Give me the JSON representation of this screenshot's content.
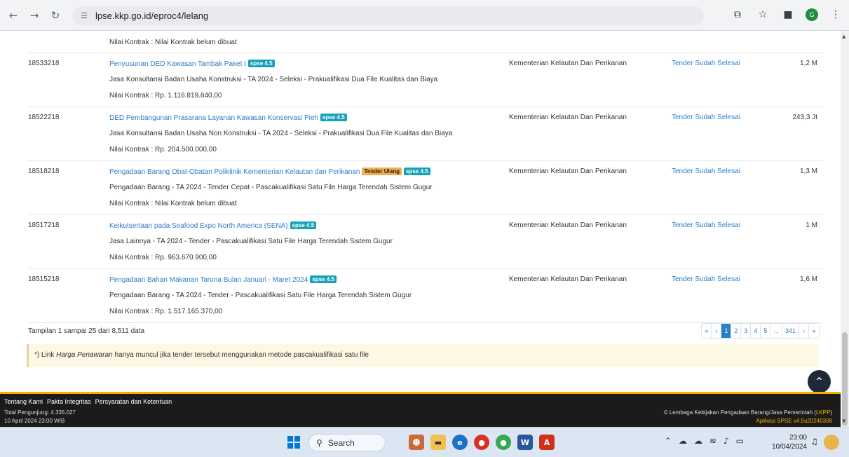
{
  "browser": {
    "url": "lpse.kkp.go.id/eproc4/lelang",
    "profile_initial": "G"
  },
  "table": {
    "first_row": {
      "nilai": "Nilai Kontrak : Nilai Kontrak belum dibuat"
    },
    "rows": [
      {
        "id": "18533218",
        "title": "Penyusunan DED Kawasan Tambak Paket I",
        "badges": [
          "spse 4.5"
        ],
        "jenis": "Jasa Konsultansi Badan Usaha Konstruksi - TA 2024 - Seleksi - Prakualifikasi Dua File Kualitas dan Biaya",
        "nilai": "Nilai Kontrak : Rp. 1.116.819.840,00",
        "instansi": "Kementerian Kelautan Dan Perikanan",
        "status": "Tender Sudah Selesai",
        "hps": "1,2 M"
      },
      {
        "id": "18522218",
        "title": "DED Pembangunan Prasarana Layanan Kawasan Konservasi Pieh",
        "badges": [
          "spse 4.5"
        ],
        "jenis": "Jasa Konsultansi Badan Usaha Non Konstruksi - TA 2024 - Seleksi - Prakualifikasi Dua File Kualitas dan Biaya",
        "nilai": "Nilai Kontrak : Rp. 204.500.000,00",
        "instansi": "Kementerian Kelautan Dan Perikanan",
        "status": "Tender Sudah Selesai",
        "hps": "243,3 Jt"
      },
      {
        "id": "18518218",
        "title": "Pengadaan Barang Obat-Obatan Poliklinik Kementerian Kelautan dan Perikanan",
        "badges": [
          "Tender Ulang",
          "spse 4.5"
        ],
        "jenis": "Pengadaan Barang - TA 2024 - Tender Cepat - Pascakualifikasi Satu File Harga Terendah Sistem Gugur",
        "nilai": "Nilai Kontrak : Nilai Kontrak belum dibuat",
        "instansi": "Kementerian Kelautan Dan Perikanan",
        "status": "Tender Sudah Selesai",
        "hps": "1,3 M"
      },
      {
        "id": "18517218",
        "title": "Keikutsertaan pada Seafood Expo North America (SENA)",
        "badges": [
          "spse 4.5"
        ],
        "jenis": "Jasa Lainnya - TA 2024 - Tender - Pascakualifikasi Satu File Harga Terendah Sistem Gugur",
        "nilai": "Nilai Kontrak : Rp. 963.670.900,00",
        "instansi": "Kementerian Kelautan Dan Perikanan",
        "status": "Tender Sudah Selesai",
        "hps": "1 M"
      },
      {
        "id": "18515218",
        "title": "Pengadaan Bahan Makanan Taruna Bulan Januari - Maret 2024",
        "badges": [
          "spse 4.5"
        ],
        "jenis": "Pengadaan Barang - TA 2024 - Tender - Pascakualifikasi Satu File Harga Terendah Sistem Gugur",
        "nilai": "Nilai Kontrak : Rp. 1.517.165.370,00",
        "instansi": "Kementerian Kelautan Dan Perikanan",
        "status": "Tender Sudah Selesai",
        "hps": "1,6 M"
      }
    ]
  },
  "info": "Tampilan 1 sampai 25 dari 8,511 data",
  "pagination": [
    "«",
    "‹",
    "1",
    "2",
    "3",
    "4",
    "5",
    "...",
    "341",
    "›",
    "»"
  ],
  "notice": {
    "prefix": "*) Link ",
    "emphasis": "Harga Penawaran",
    "suffix": " hanya muncul jika tender tersebut menggunakan metode pascakualifikasi satu file"
  },
  "footer": {
    "links": [
      "Tentang Kami",
      "Pakta Integritas",
      "Persyaratan dan Ketentuan"
    ],
    "total": "Total Pengunjung: 4.335.027",
    "date": "10 April 2024 23:00 WIB",
    "copyright_prefix": "© Lembaga Kebijakan Pengadaan Barang/Jasa Pemerintah (",
    "copyright_link": "LKPP",
    "copyright_suffix": ")",
    "app": "Aplikasi SPSE v4.5u20240308"
  },
  "taskbar": {
    "search_label": "Search",
    "time": "23:00",
    "date": "10/04/2024"
  }
}
